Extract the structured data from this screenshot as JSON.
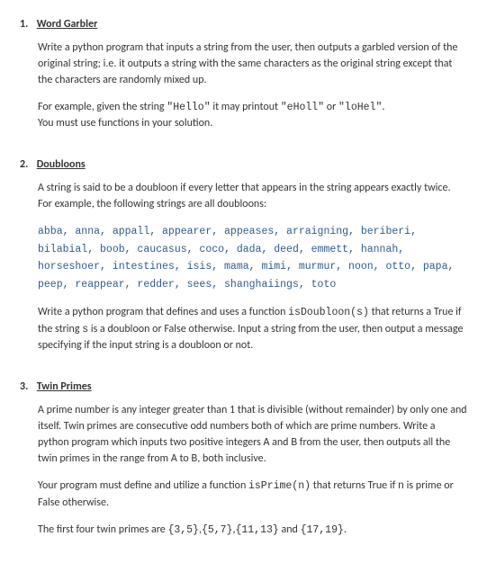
{
  "problems": [
    {
      "number": "1.",
      "title": "Word Garbler",
      "p1": "Write a python program that inputs a string from the user, then outputs a garbled version of the original string; i.e. it outputs a string with the same characters as the original string except that the characters are randomly mixed up.",
      "p2_prefix": "For example, given the string ",
      "p2_code1": "\"Hello\"",
      "p2_mid1": " it may printout ",
      "p2_code2": "\"eHoll\"",
      "p2_mid2": " or ",
      "p2_code3": "\"loHel\"",
      "p2_suffix": ".",
      "p3": "You must use functions in your solution."
    },
    {
      "number": "2.",
      "title": "Doubloons",
      "p1": "A string is said to be a doubloon if every letter that appears in the string appears exactly twice. For example, the following strings are all doubloons:",
      "examples": "abba, anna, appall, appearer, appeases, arraigning, beriberi, bilabial, boob, caucasus, coco, dada, deed, emmett, hannah, horseshoer, intestines, isis, mama, mimi, murmur, noon, otto, papa, peep, reappear, redder, sees, shanghaiings, toto",
      "p2_a": "Write a python program that defines and uses a function ",
      "p2_code": "isDoubloon(s)",
      "p2_b": " that returns a True if the string ",
      "p2_code2": "s",
      "p2_c": " is a doubloon or False otherwise. Input a string from the user, then output a message specifying if the input string is a doubloon or not."
    },
    {
      "number": "3.",
      "title": "Twin Primes",
      "p1_a": "A prime number is any integer greater than 1 that is divisible (without remainder) by only one and itself. Twin primes are consecutive odd numbers both of which are prime numbers. Write a python program which inputs two positive integers ",
      "p1_codeA": "A",
      "p1_b": " and ",
      "p1_codeB": "B",
      "p1_c": " from the user, then outputs all the twin primes in the range from ",
      "p1_codeA2": "A",
      "p1_d": " to ",
      "p1_codeB2": "B",
      "p1_e": ", both inclusive.",
      "p2_a": "Your program must define and utilize a function ",
      "p2_code": "isPrime(n)",
      "p2_b": "  that returns True if ",
      "p2_code2": "n",
      "p2_c": " is prime or False otherwise.",
      "p3_a": "The first four twin primes are ",
      "p3_c1": "{3,5}",
      "p3_s1": ",",
      "p3_c2": "{5,7}",
      "p3_s2": ",",
      "p3_c3": "{11,13}",
      "p3_s3": " and ",
      "p3_c4": "{17,19}",
      "p3_s4": "."
    }
  ]
}
